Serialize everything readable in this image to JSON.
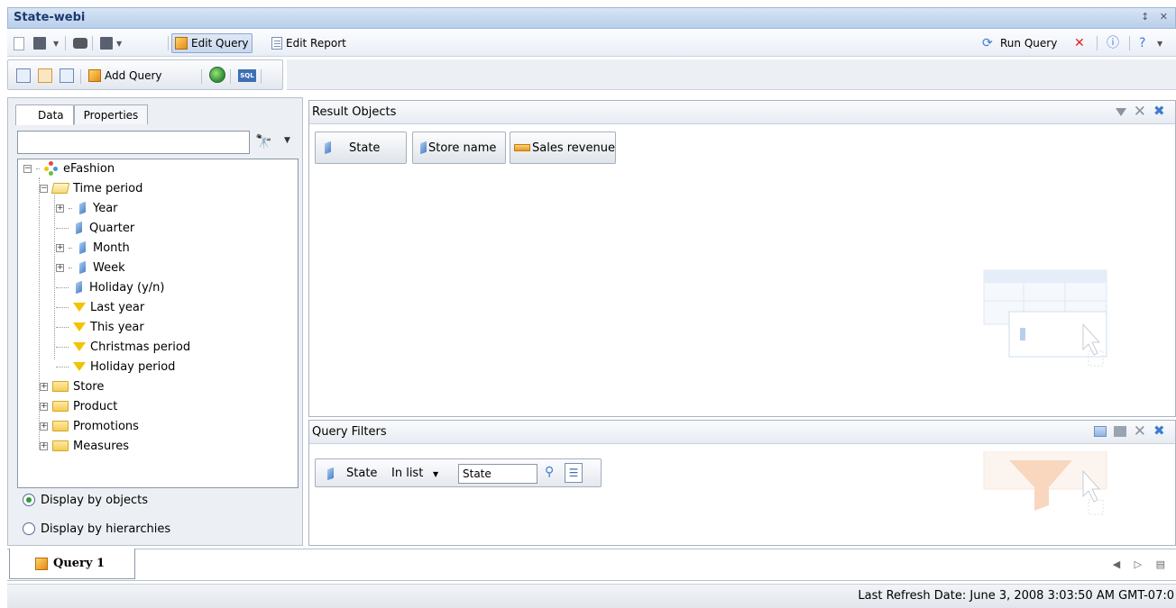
{
  "window": {
    "title": "State-webi",
    "controls": "↕ ✕"
  },
  "toolbar": {
    "edit_query": "Edit Query",
    "edit_report": "Edit Report",
    "run_query": "Run Query"
  },
  "query_toolbar": {
    "add_query": "Add Query",
    "sql_label": "SQL"
  },
  "left_panel": {
    "tabs": [
      "Data",
      "Properties"
    ],
    "search": {
      "value": "",
      "placeholder": ""
    },
    "tree": {
      "root": "eFashion",
      "time_period": "Time period",
      "time_children": [
        "Year",
        "Quarter",
        "Month",
        "Week",
        "Holiday (y/n)"
      ],
      "filters": [
        "Last year",
        "This year",
        "Christmas period",
        "Holiday period"
      ],
      "folders": [
        "Store",
        "Product",
        "Promotions",
        "Measures"
      ]
    },
    "display_options": [
      "Display by objects",
      "Display by hierarchies"
    ],
    "selected_display": "Display by objects"
  },
  "result_objects": {
    "title": "Result Objects",
    "objects": [
      "State",
      "Store name",
      "Sales revenue"
    ]
  },
  "query_filters": {
    "title": "Query Filters",
    "filter": {
      "object": "State",
      "operator": "In list",
      "value": "State"
    }
  },
  "query_tabs": {
    "active": "Query 1"
  },
  "status": {
    "last_refresh": "Last Refresh Date: June 3, 2008 3:03:50 AM GMT-07:0"
  },
  "colors": {
    "title_text": "#1b3a70",
    "filter_yellow": "#f2c300",
    "dimension_blue": "#4a82c9",
    "measure_orange": "#e89a1e"
  }
}
